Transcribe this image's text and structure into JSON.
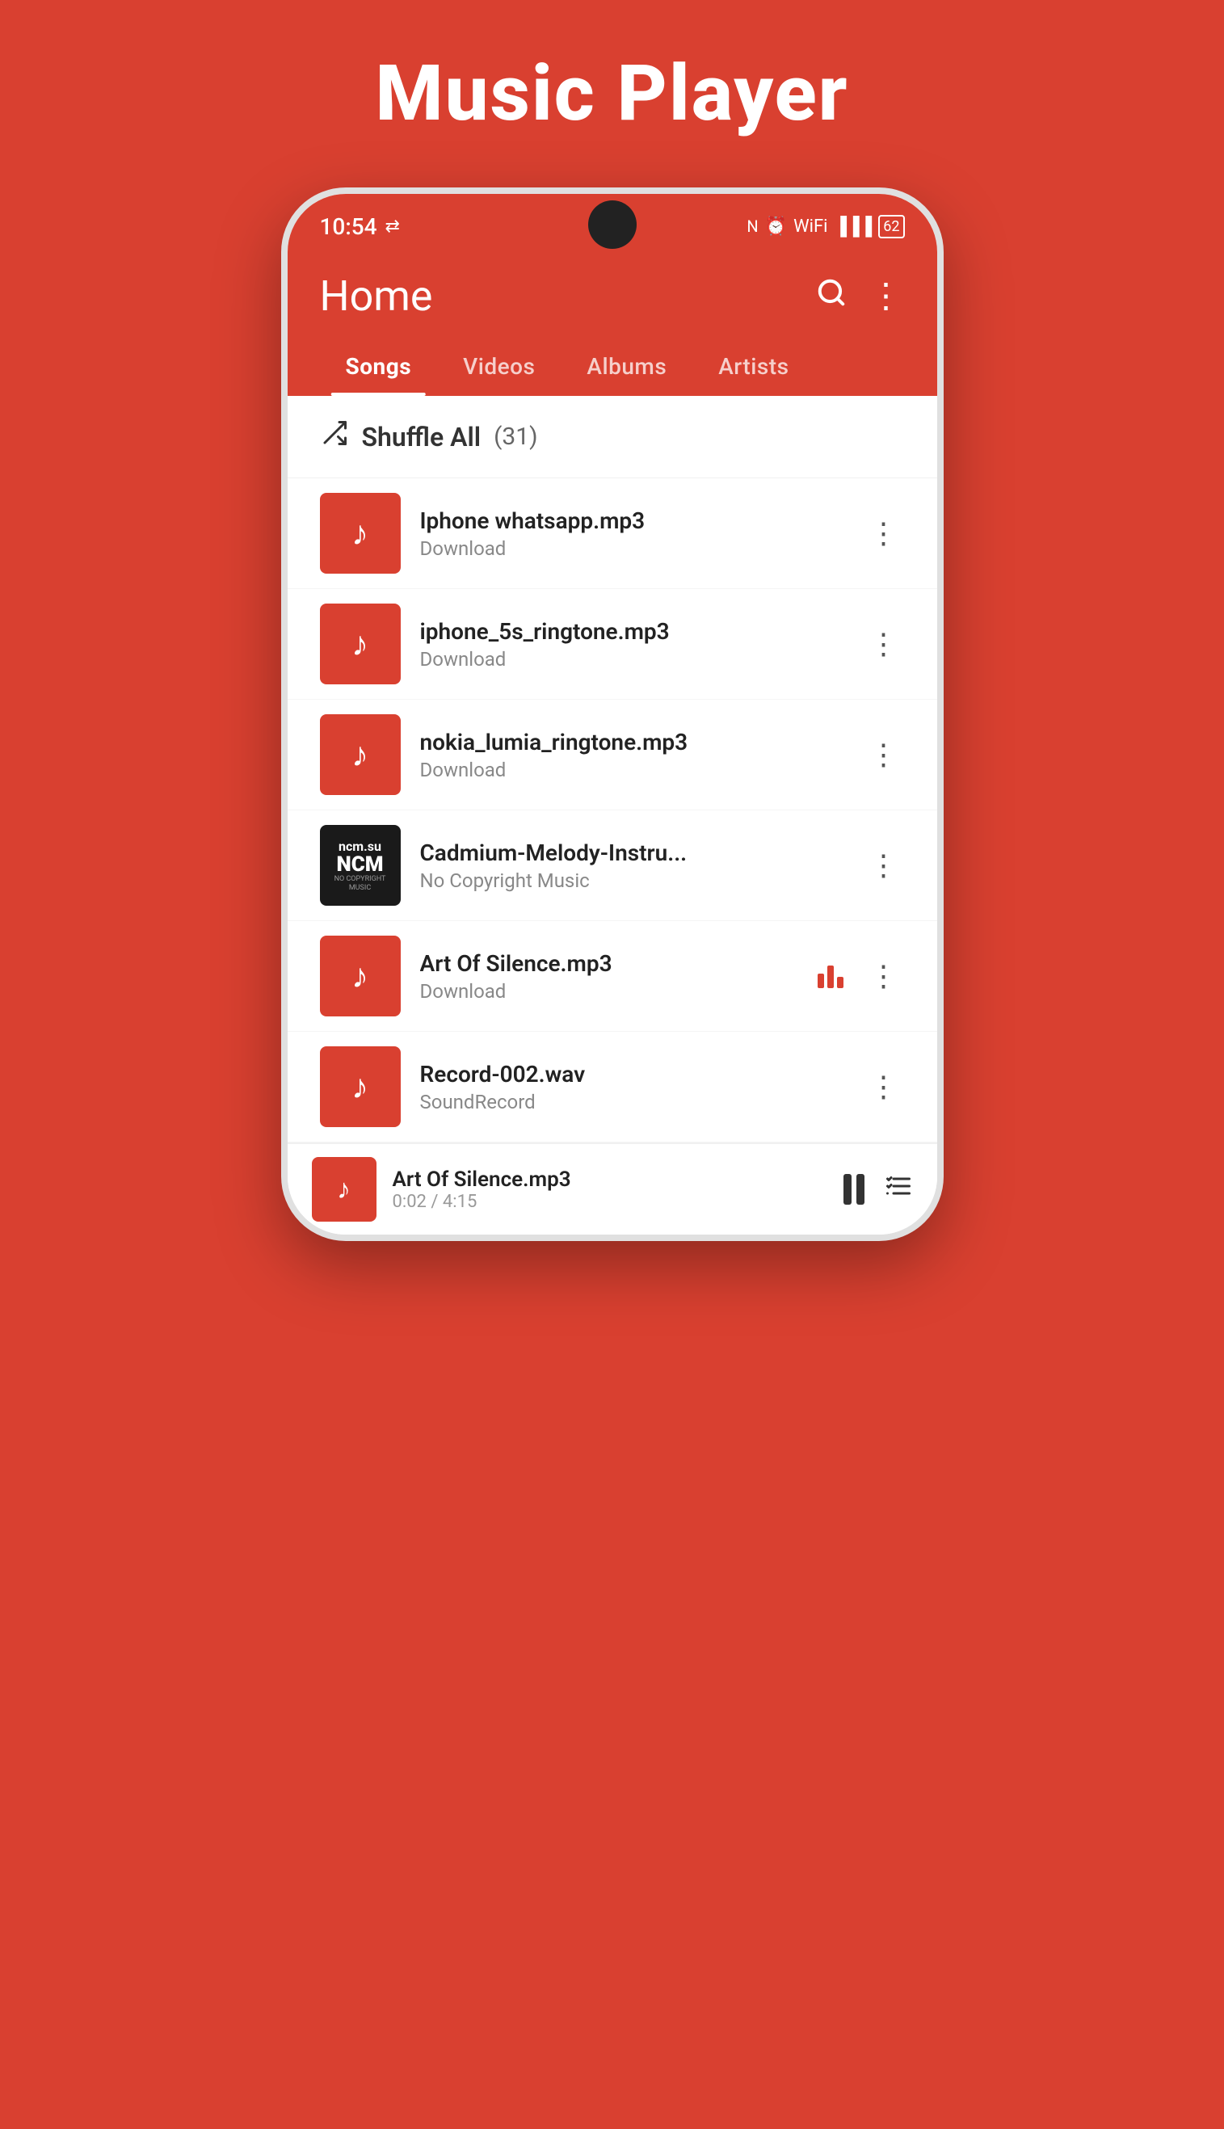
{
  "page": {
    "title": "Music Player",
    "bg_color": "#d94030"
  },
  "status_bar": {
    "time": "10:54",
    "battery": "62"
  },
  "header": {
    "title": "Home",
    "search_label": "Search",
    "menu_label": "More options"
  },
  "tabs": [
    {
      "id": "songs",
      "label": "Songs",
      "active": true
    },
    {
      "id": "videos",
      "label": "Videos",
      "active": false
    },
    {
      "id": "albums",
      "label": "Albums",
      "active": false
    },
    {
      "id": "artists",
      "label": "Artists",
      "active": false
    }
  ],
  "shuffle": {
    "label": "Shuffle All",
    "count": "(31)"
  },
  "songs": [
    {
      "id": 1,
      "title": "Iphone whatsapp.mp3",
      "artist": "Download",
      "has_thumb": false,
      "is_playing": false,
      "has_ncm": false
    },
    {
      "id": 2,
      "title": "iphone_5s_ringtone.mp3",
      "artist": "Download",
      "has_thumb": false,
      "is_playing": false,
      "has_ncm": false
    },
    {
      "id": 3,
      "title": "nokia_lumia_ringtone.mp3",
      "artist": "Download",
      "has_thumb": false,
      "is_playing": false,
      "has_ncm": false
    },
    {
      "id": 4,
      "title": "Cadmium-Melody-Instru...",
      "artist": "No Copyright Music",
      "has_thumb": false,
      "is_playing": false,
      "has_ncm": true
    },
    {
      "id": 5,
      "title": "Art Of Silence.mp3",
      "artist": "Download",
      "has_thumb": false,
      "is_playing": true,
      "has_ncm": false
    },
    {
      "id": 6,
      "title": "Record-002.wav",
      "artist": "SoundRecord",
      "has_thumb": false,
      "is_playing": false,
      "has_ncm": false
    }
  ],
  "mini_player": {
    "title": "Art Of Silence.mp3",
    "current_time": "0:02",
    "total_time": "4:15",
    "time_display": "0:02 / 4:15"
  },
  "ncm": {
    "top": "ncm.su",
    "main": "NCM",
    "sub": "NO COPYRIGHT MUSIC"
  }
}
